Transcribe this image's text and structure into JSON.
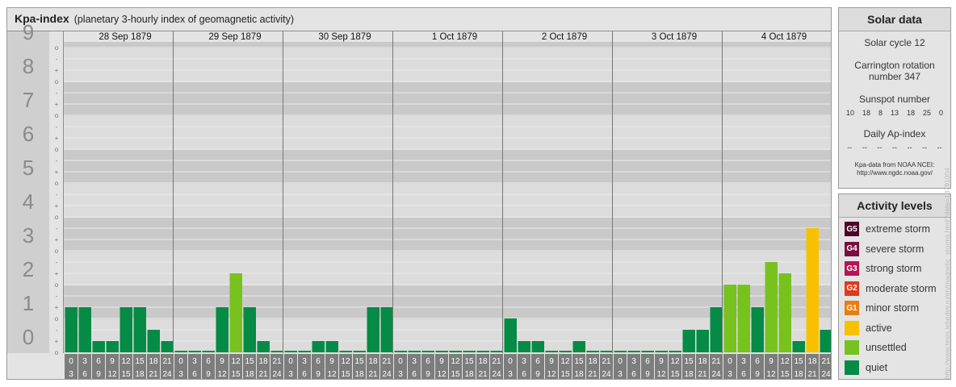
{
  "header": {
    "title": "Kpa-index",
    "subtitle": "(planetary 3-hourly index of geomagnetic activity)"
  },
  "colors": {
    "quiet": "#058b45",
    "unsettled": "#77c21e",
    "active": "#f7c100",
    "minor_storm": "#e67f12",
    "moderate_storm": "#dc3b1c",
    "strong_storm": "#b81254",
    "severe_storm": "#7a0c42",
    "extreme_storm": "#4c0729"
  },
  "chart_data": {
    "type": "bar",
    "title": "Kpa-index",
    "subtitle": "(planetary 3-hourly index of geomagnetic activity)",
    "y_levels": [
      "0",
      "1",
      "2",
      "3",
      "4",
      "5",
      "6",
      "7",
      "8",
      "9"
    ],
    "y_minor_marks": [
      "-",
      "o",
      "+"
    ],
    "ylim": [
      0,
      9.33
    ],
    "days": [
      {
        "date": "28 Sep 1879",
        "values": [
          1.33,
          1.33,
          0.33,
          0.33,
          1.33,
          1.33,
          0.67,
          0.33
        ]
      },
      {
        "date": "29 Sep 1879",
        "values": [
          0,
          0,
          0,
          1.33,
          2.33,
          1.33,
          0.33,
          0
        ]
      },
      {
        "date": "30 Sep 1879",
        "values": [
          0,
          0,
          0.33,
          0.33,
          0,
          0,
          1.33,
          1.33
        ]
      },
      {
        "date": "1 Oct 1879",
        "values": [
          0,
          0,
          0,
          0,
          0,
          0,
          0,
          0
        ]
      },
      {
        "date": "2 Oct 1879",
        "values": [
          1.0,
          0.33,
          0.33,
          0,
          0,
          0.33,
          0,
          0
        ]
      },
      {
        "date": "3 Oct 1879",
        "values": [
          0,
          0,
          0,
          0,
          0,
          0.67,
          0.67,
          1.33
        ]
      },
      {
        "date": "4 Oct 1879",
        "values": [
          2.0,
          2.0,
          1.33,
          2.67,
          2.33,
          0.33,
          3.67,
          0.67
        ]
      }
    ],
    "hour_ranges": [
      [
        "0",
        "3"
      ],
      [
        "3",
        "6"
      ],
      [
        "6",
        "9"
      ],
      [
        "9",
        "12"
      ],
      [
        "12",
        "15"
      ],
      [
        "15",
        "18"
      ],
      [
        "18",
        "21"
      ],
      [
        "21",
        "24"
      ]
    ]
  },
  "solar": {
    "heading": "Solar data",
    "solar_cycle": "Solar cycle 12",
    "carrington_line1": "Carrington rotation",
    "carrington_line2": "number 347",
    "sunspot_heading": "Sunspot number",
    "sunspot_values": [
      "10",
      "18",
      "8",
      "13",
      "18",
      "25",
      "0"
    ],
    "ap_heading": "Daily Ap-index",
    "ap_values": [
      "--",
      "--",
      "--",
      "--",
      "--",
      "--",
      "--"
    ],
    "credit_line1": "Kpa-data from NOAA NCEI:",
    "credit_line2": "http://www.ngdc.noaa.gov/"
  },
  "activity": {
    "heading": "Activity levels",
    "items": [
      {
        "badge": "G5",
        "label": "extreme storm",
        "color": "#4c0729"
      },
      {
        "badge": "G4",
        "label": "severe storm",
        "color": "#7a0c42"
      },
      {
        "badge": "G3",
        "label": "strong storm",
        "color": "#b81254"
      },
      {
        "badge": "G2",
        "label": "moderate storm",
        "color": "#dc3b1c"
      },
      {
        "badge": "G1",
        "label": "minor storm",
        "color": "#e67f12"
      },
      {
        "badge": "",
        "label": "active",
        "color": "#f7c100"
      },
      {
        "badge": "",
        "label": "unsettled",
        "color": "#77c21e"
      },
      {
        "badge": "",
        "label": "quiet",
        "color": "#058b45"
      }
    ]
  },
  "side_url": "http://www.tesis.lebedev.ru/en/magnetic_storms.html?date=18791004"
}
